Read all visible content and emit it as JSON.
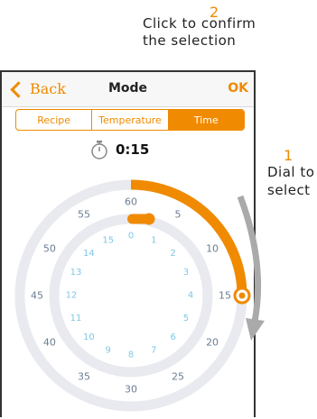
{
  "annotations": {
    "step2_number": "2",
    "step2_line1": "Click to confirm",
    "step2_line2": "the selection",
    "step1_number": "1",
    "step1_line1": "Dial to",
    "step1_line2": "select"
  },
  "navbar": {
    "back_label": "Back",
    "title": "Mode",
    "ok_label": "OK"
  },
  "tabs": [
    {
      "label": "Recipe",
      "active": false
    },
    {
      "label": "Temperature",
      "active": false
    },
    {
      "label": "Time",
      "active": true
    }
  ],
  "timer": {
    "icon": "stopwatch-icon",
    "value": "0:15"
  },
  "dial": {
    "outer_labels": [
      "60",
      "5",
      "10",
      "15",
      "20",
      "25",
      "30",
      "35",
      "40",
      "45",
      "50",
      "55"
    ],
    "inner_labels": [
      "0",
      "1",
      "2",
      "3",
      "4",
      "5",
      "6",
      "7",
      "8",
      "9",
      "10",
      "11",
      "12",
      "13",
      "14",
      "15"
    ],
    "outer_fraction": 0.25,
    "inner_fraction": 0.0,
    "accent_color": "#f08a00",
    "outer_label_color": "#6b7d92",
    "inner_label_color": "#7fc7e6",
    "track_color": "#e9eaf0"
  }
}
